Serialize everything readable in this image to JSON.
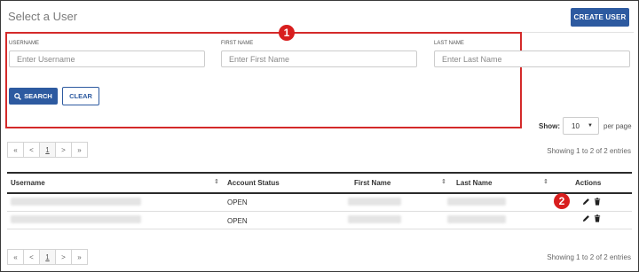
{
  "header": {
    "title": "Select a User",
    "create_label": "CREATE USER"
  },
  "callouts": [
    "1",
    "2"
  ],
  "search": {
    "username_label": "USERNAME",
    "username_placeholder": "Enter Username",
    "firstname_label": "FIRST NAME",
    "firstname_placeholder": "Enter First Name",
    "lastname_label": "LAST NAME",
    "lastname_placeholder": "Enter Last Name",
    "search_label": "SEARCH",
    "clear_label": "CLEAR"
  },
  "paging": {
    "show_label": "Show:",
    "show_value": "10",
    "per_page": "per page",
    "pager": [
      "«",
      "<",
      "1",
      ">",
      "»"
    ],
    "entries_text": "Showing 1 to 2 of 2 entries"
  },
  "table": {
    "columns": [
      "Username",
      "Account Status",
      "First Name",
      "Last Name",
      "Actions"
    ],
    "rows": [
      {
        "status": "OPEN"
      },
      {
        "status": "OPEN"
      }
    ]
  },
  "icons": {
    "edit": "pencil-icon",
    "delete": "trash-icon",
    "search": "search-icon",
    "sort": "sort-icon"
  },
  "colors": {
    "primary": "#2d5aa0",
    "callout": "#d42a2a"
  }
}
